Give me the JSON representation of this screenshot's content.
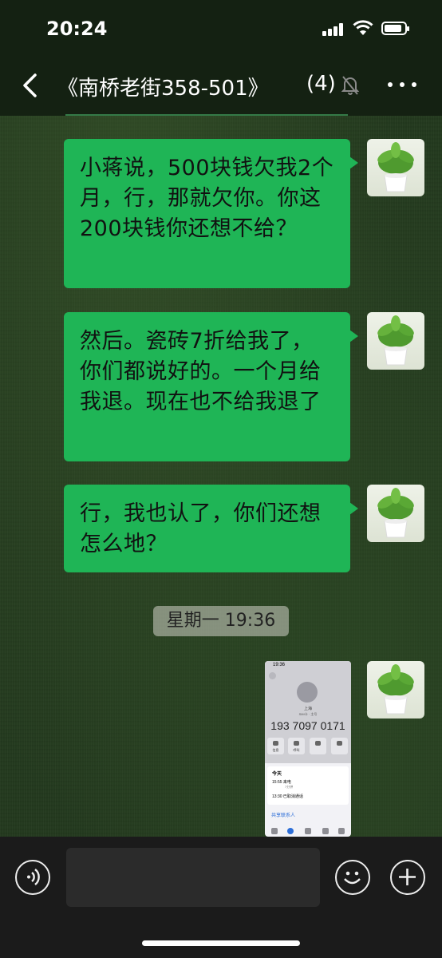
{
  "status": {
    "time": "20:24"
  },
  "header": {
    "title": "《南桥老街358-501》",
    "count": "(4)"
  },
  "messages": [
    {
      "text": "小蒋说，500块钱欠我2个月，行，那就欠你。你这200块钱你还想不给？"
    },
    {
      "text": "然后。瓷砖7折给我了，你们都说好的。一个月给我退。现在也不给我退了"
    },
    {
      "text": "行，我也认了，你们还想怎么地？"
    }
  ],
  "timestamp": "星期一 19:36",
  "screenshot": {
    "time": "19:36",
    "location": "上海",
    "sim": "SIM卡 · 主号",
    "number": "193 7097 0171",
    "actions": [
      "信息",
      "呼叫",
      "",
      ""
    ],
    "today": "今天",
    "call1_time": "15:55",
    "call1_label": "来电",
    "call1_duration": "7分钟",
    "call2_time": "13:30",
    "call2_label": "已取消通话",
    "share": "共享联系人"
  },
  "icons": {
    "back": "chevron-left-icon",
    "mute": "bell-slash-icon",
    "more": "more-dots-icon",
    "voice": "voice-icon",
    "emoji": "emoji-icon",
    "plus": "plus-icon"
  }
}
